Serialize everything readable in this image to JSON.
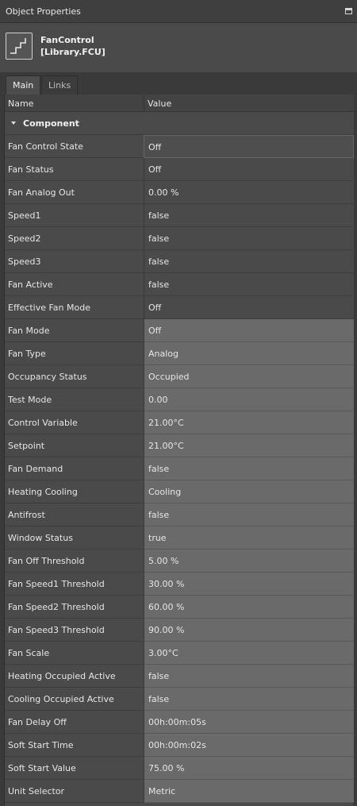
{
  "panel": {
    "title": "Object Properties"
  },
  "object": {
    "name_line1": "FanControl",
    "name_line2": "[Library.FCU]",
    "icon": "stair-step-icon"
  },
  "tabs": [
    {
      "label": "Main"
    },
    {
      "label": "Links"
    }
  ],
  "columns": {
    "name": "Name",
    "value": "Value"
  },
  "group": {
    "label": "Component"
  },
  "rows": [
    {
      "name": "Fan Control State",
      "value": "Off"
    },
    {
      "name": "Fan Status",
      "value": "Off"
    },
    {
      "name": "Fan Analog Out",
      "value": "0.00 %"
    },
    {
      "name": "Speed1",
      "value": "false"
    },
    {
      "name": "Speed2",
      "value": "false"
    },
    {
      "name": "Speed3",
      "value": "false"
    },
    {
      "name": "Fan Active",
      "value": "false"
    },
    {
      "name": "Effective Fan Mode",
      "value": "Off"
    },
    {
      "name": "Fan Mode",
      "value": "Off"
    },
    {
      "name": "Fan Type",
      "value": "Analog"
    },
    {
      "name": "Occupancy Status",
      "value": "Occupied"
    },
    {
      "name": "Test Mode",
      "value": "0.00"
    },
    {
      "name": "Control Variable",
      "value": "21.00°C"
    },
    {
      "name": "Setpoint",
      "value": "21.00°C"
    },
    {
      "name": "Fan Demand",
      "value": "false"
    },
    {
      "name": "Heating Cooling",
      "value": "Cooling"
    },
    {
      "name": "Antifrost",
      "value": "false"
    },
    {
      "name": "Window Status",
      "value": "true"
    },
    {
      "name": "Fan Off Threshold",
      "value": "5.00 %"
    },
    {
      "name": "Fan Speed1 Threshold",
      "value": "30.00 %"
    },
    {
      "name": "Fan Speed2 Threshold",
      "value": "60.00 %"
    },
    {
      "name": "Fan Speed3 Threshold",
      "value": "90.00 %"
    },
    {
      "name": "Fan Scale",
      "value": "3.00°C"
    },
    {
      "name": "Heating Occupied Active",
      "value": "false"
    },
    {
      "name": "Cooling Occupied Active",
      "value": "false"
    },
    {
      "name": "Fan Delay Off",
      "value": "00h:00m:05s"
    },
    {
      "name": "Soft Start Time",
      "value": "00h:00m:02s"
    },
    {
      "name": "Soft Start Value",
      "value": "75.00 %"
    },
    {
      "name": "Unit Selector",
      "value": "Metric"
    }
  ]
}
